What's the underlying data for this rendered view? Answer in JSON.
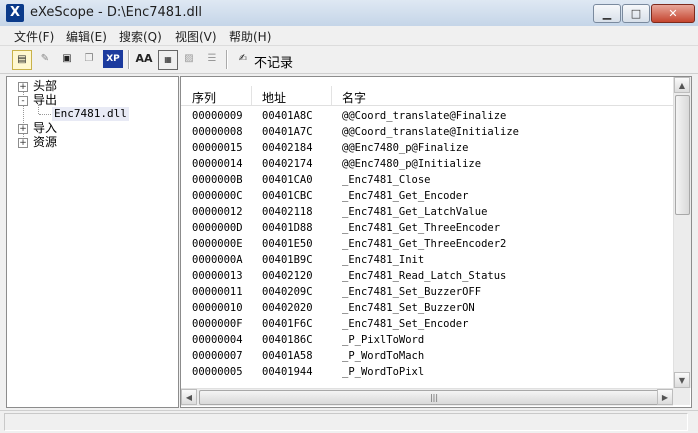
{
  "window": {
    "title": "eXeScope - D:\\Enc7481.dll",
    "icon": "exescope-app-icon"
  },
  "menu": [
    "文件(F)",
    "编辑(E)",
    "搜索(Q)",
    "视图(V)",
    "帮助(H)"
  ],
  "toolbar": {
    "icons": [
      "new-icon",
      "edit-icon",
      "save-icon",
      "copy-icon",
      "xp-icon",
      "font-icon",
      "dialog-icon",
      "image-icon",
      "list-icon",
      "no-record-icon"
    ],
    "xp_text": "XP",
    "no_record_label": "不记录"
  },
  "tree": {
    "nodes": [
      {
        "label": "头部",
        "expander": "+"
      },
      {
        "label": "导出",
        "expander": "-"
      },
      {
        "label": "Enc7481.dll",
        "child": true
      },
      {
        "label": "导入",
        "expander": "+"
      },
      {
        "label": "资源",
        "expander": "+"
      }
    ]
  },
  "table": {
    "columns": [
      "序列",
      "地址",
      "名字"
    ],
    "rows": [
      [
        "00000009",
        "00401A8C",
        "@@Coord_translate@Finalize"
      ],
      [
        "00000008",
        "00401A7C",
        "@@Coord_translate@Initialize"
      ],
      [
        "00000015",
        "00402184",
        "@@Enc7480_p@Finalize"
      ],
      [
        "00000014",
        "00402174",
        "@@Enc7480_p@Initialize"
      ],
      [
        "0000000B",
        "00401CA0",
        "_Enc7481_Close"
      ],
      [
        "0000000C",
        "00401CBC",
        "_Enc7481_Get_Encoder"
      ],
      [
        "00000012",
        "00402118",
        "_Enc7481_Get_LatchValue"
      ],
      [
        "0000000D",
        "00401D88",
        "_Enc7481_Get_ThreeEncoder"
      ],
      [
        "0000000E",
        "00401E50",
        "_Enc7481_Get_ThreeEncoder2"
      ],
      [
        "0000000A",
        "00401B9C",
        "_Enc7481_Init"
      ],
      [
        "00000013",
        "00402120",
        "_Enc7481_Read_Latch_Status"
      ],
      [
        "00000011",
        "0040209C",
        "_Enc7481_Set_BuzzerOFF"
      ],
      [
        "00000010",
        "00402020",
        "_Enc7481_Set_BuzzerON"
      ],
      [
        "0000000F",
        "00401F6C",
        "_Enc7481_Set_Encoder"
      ],
      [
        "00000004",
        "0040186C",
        "_P_PixlToWord"
      ],
      [
        "00000007",
        "00401A58",
        "_P_WordToMach"
      ],
      [
        "00000005",
        "00401944",
        "_P_WordToPixl"
      ]
    ]
  },
  "scrollbar_icons": {
    "up": "▲",
    "down": "▼",
    "left": "◀",
    "right": "▶",
    "grip": "|||"
  }
}
